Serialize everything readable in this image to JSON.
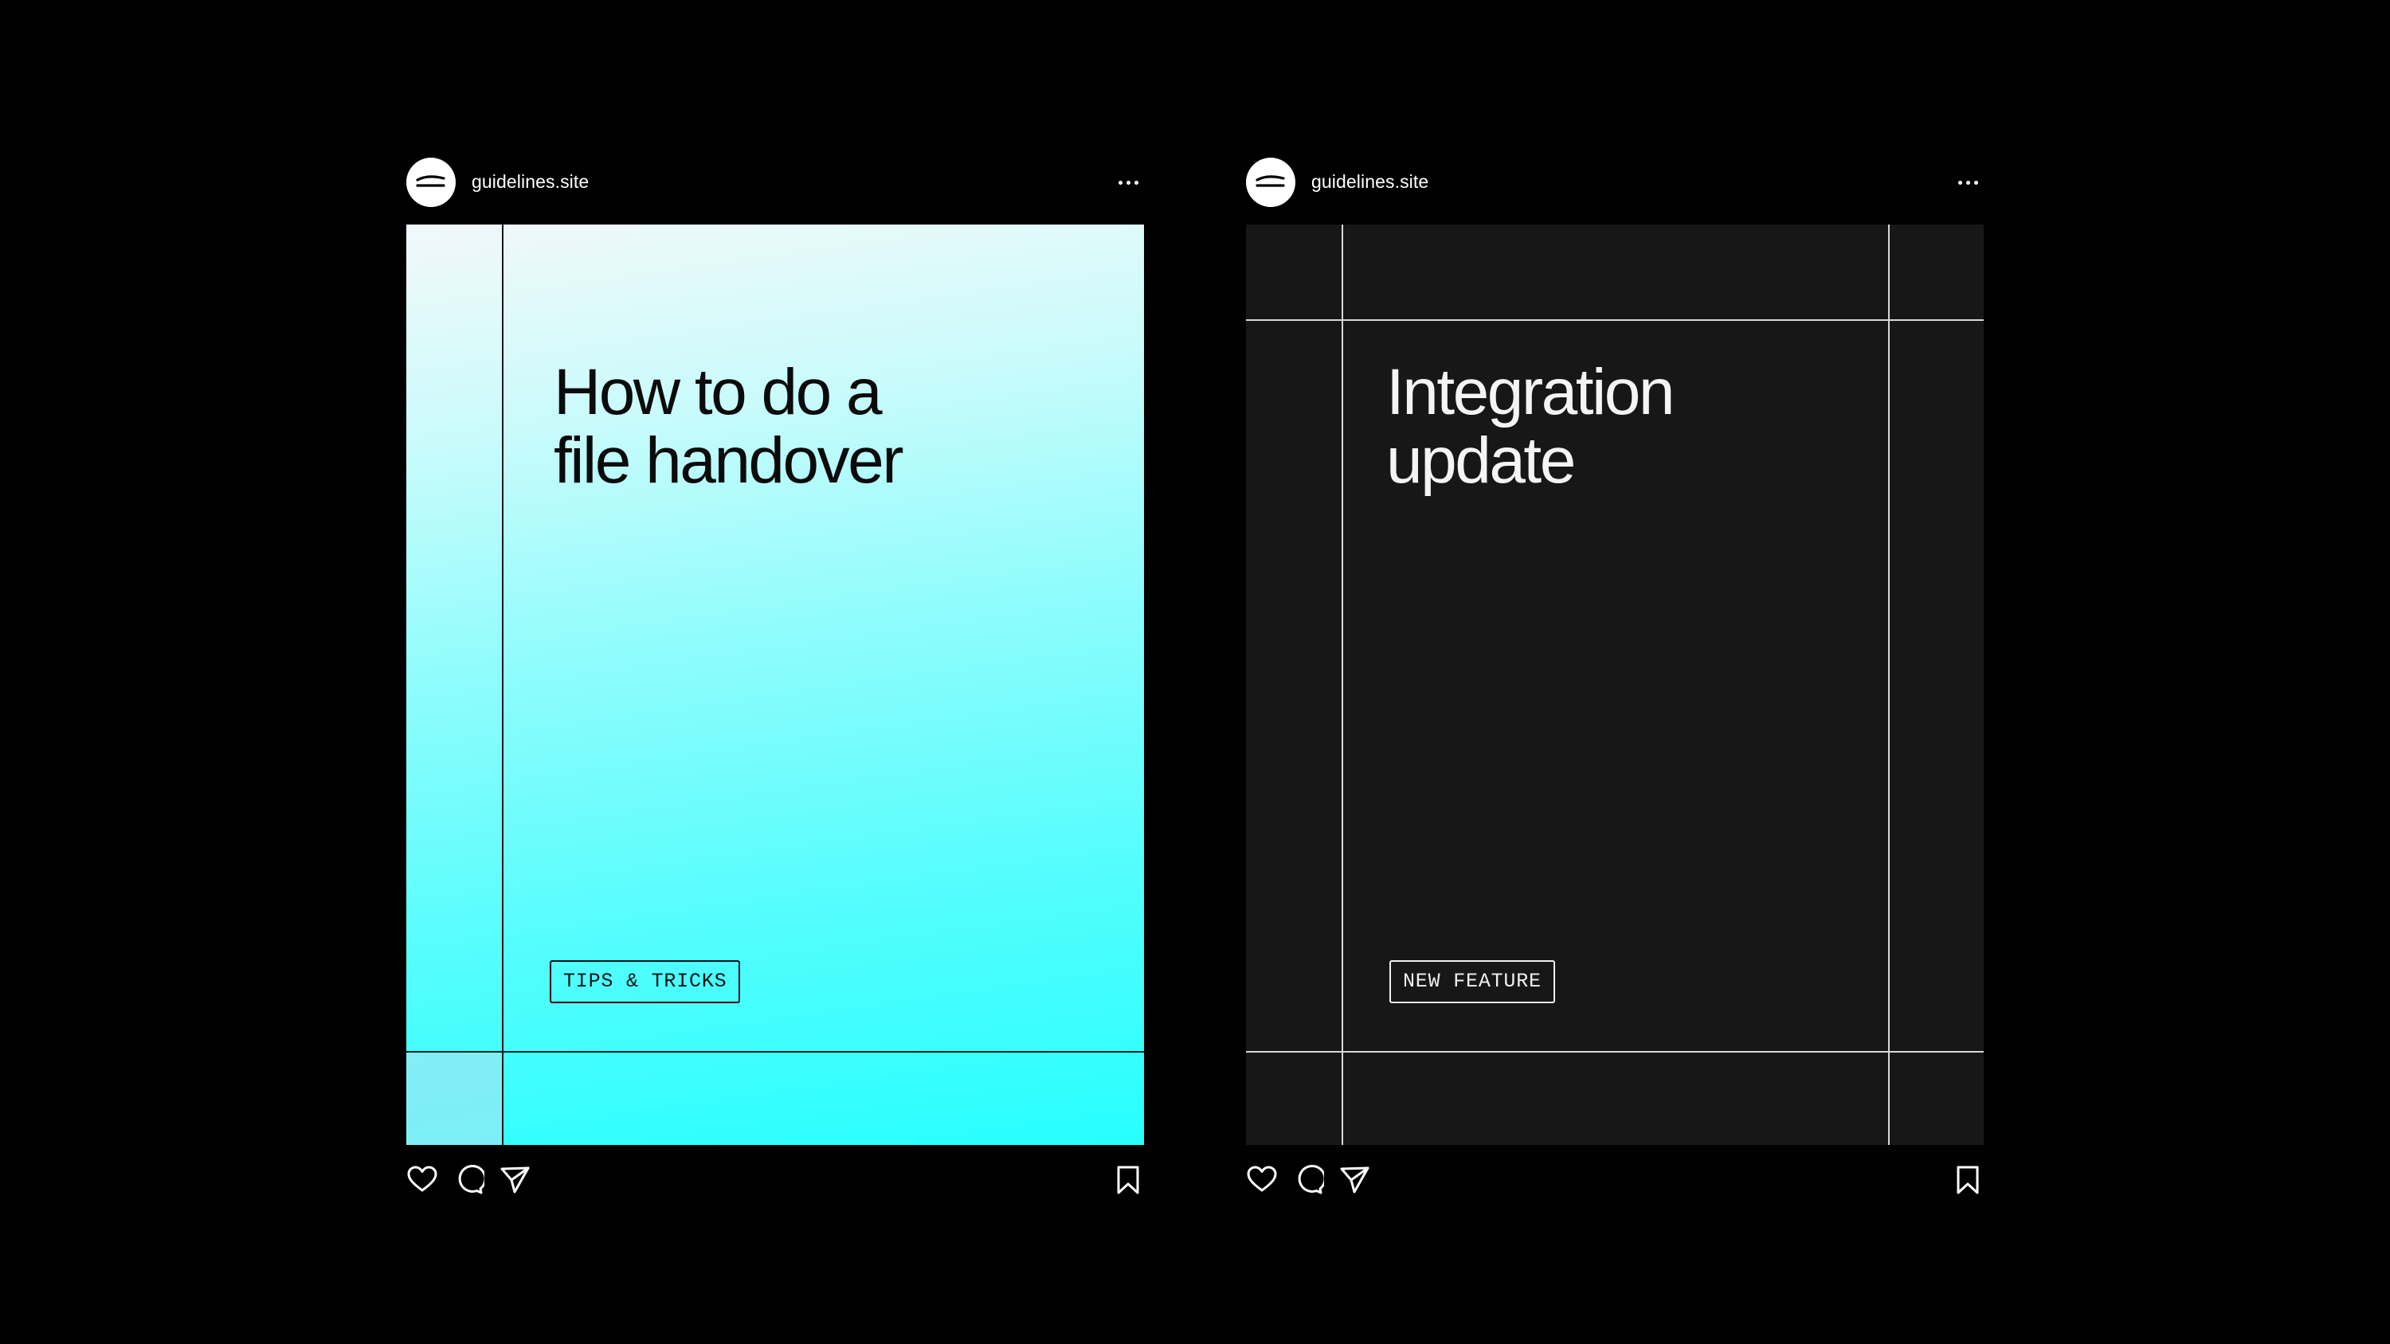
{
  "posts": [
    {
      "account": "guidelines.site",
      "headline": [
        "How to do a",
        "file handover"
      ],
      "tag": "TIPS & TRICKS",
      "theme": {
        "background": "gradient-cyan",
        "line_color": "#0e1a1c",
        "text_color": "#0b0b0b"
      }
    },
    {
      "account": "guidelines.site",
      "headline": [
        "Integration",
        "update"
      ],
      "tag": "NEW FEATURE",
      "theme": {
        "background": "#171717",
        "line_color": "#d8d8d8",
        "text_color": "#f4f4f4"
      }
    }
  ],
  "icons": {
    "avatar": "logo-icon",
    "more": "more-options-icon",
    "like": "heart-icon",
    "comment": "comment-bubble-icon",
    "share": "paper-plane-icon",
    "save": "bookmark-icon"
  },
  "colors": {
    "page_background": "#000000",
    "ui_foreground": "#ffffff"
  }
}
